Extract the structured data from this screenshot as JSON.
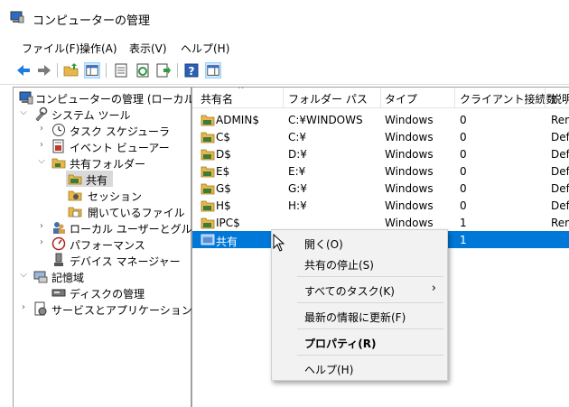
{
  "window": {
    "title": "コンピューターの管理"
  },
  "menu": [
    "ファイル(F)",
    "操作(A)",
    "表示(V)",
    "ヘルプ(H)"
  ],
  "tree": [
    {
      "label": "コンピューターの管理 (ローカル)",
      "icon": "computer-icon"
    },
    {
      "label": "システム ツール",
      "icon": "tools-icon"
    },
    {
      "label": "タスク スケジューラ",
      "icon": "clock-icon"
    },
    {
      "label": "イベント ビューアー",
      "icon": "event-viewer-icon"
    },
    {
      "label": "共有フォルダー",
      "icon": "shared-folder-icon"
    },
    {
      "label": "共有",
      "icon": "share-icon"
    },
    {
      "label": "セッション",
      "icon": "session-icon"
    },
    {
      "label": "開いているファイル",
      "icon": "open-files-icon"
    },
    {
      "label": "ローカル ユーザーとグループ",
      "icon": "users-icon"
    },
    {
      "label": "パフォーマンス",
      "icon": "performance-icon"
    },
    {
      "label": "デバイス マネージャー",
      "icon": "device-manager-icon"
    },
    {
      "label": "記憶域",
      "icon": "storage-icon"
    },
    {
      "label": "ディスクの管理",
      "icon": "disk-icon"
    },
    {
      "label": "サービスとアプリケーション",
      "icon": "services-icon"
    }
  ],
  "columns": [
    "共有名",
    "フォルダー パス",
    "タイプ",
    "クライアント接続数",
    "説明"
  ],
  "shares": [
    {
      "name": "ADMIN$",
      "path": "C:¥WINDOWS",
      "type": "Windows",
      "clients": "0",
      "desc": "Rem"
    },
    {
      "name": "C$",
      "path": "C:¥",
      "type": "Windows",
      "clients": "0",
      "desc": "Defa"
    },
    {
      "name": "D$",
      "path": "D:¥",
      "type": "Windows",
      "clients": "0",
      "desc": "Defa"
    },
    {
      "name": "E$",
      "path": "E:¥",
      "type": "Windows",
      "clients": "0",
      "desc": "Defa"
    },
    {
      "name": "G$",
      "path": "G:¥",
      "type": "Windows",
      "clients": "0",
      "desc": "Defa"
    },
    {
      "name": "H$",
      "path": "H:¥",
      "type": "Windows",
      "clients": "0",
      "desc": "Defa"
    },
    {
      "name": "IPC$",
      "path": "",
      "type": "Windows",
      "clients": "1",
      "desc": "Rem"
    },
    {
      "name": "共有",
      "path": "",
      "type": "",
      "clients": "1",
      "desc": ""
    }
  ],
  "context_menu": [
    {
      "label": "開く(O)"
    },
    {
      "label": "共有の停止(S)"
    },
    {
      "label": "すべてのタスク(K)",
      "submenu": true
    },
    {
      "label": "最新の情報に更新(F)"
    },
    {
      "label": "プロパティ(R)",
      "bold": true
    },
    {
      "label": "ヘルプ(H)"
    }
  ],
  "submenu_arrow": "›",
  "colors": {
    "selection": "#0078d7",
    "tree_selection": "#d9d9d9",
    "menu_bg": "#f2f2f2"
  }
}
